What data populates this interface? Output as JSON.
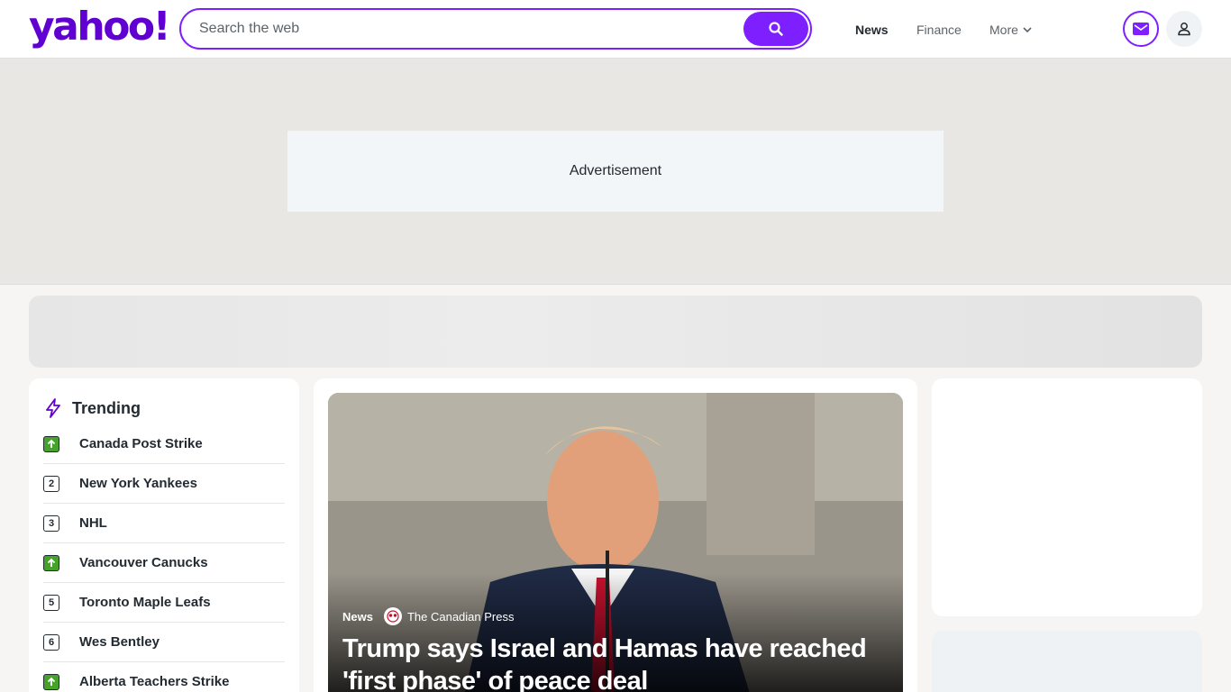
{
  "header": {
    "logo": "yahoo!",
    "search": {
      "placeholder": "Search the web",
      "value": ""
    },
    "nav": {
      "news": "News",
      "finance": "Finance",
      "more": "More"
    }
  },
  "ad": {
    "label": "Advertisement"
  },
  "trending": {
    "title": "Trending",
    "items": [
      {
        "rank": "",
        "label": "Canada Post Strike",
        "trend": "up"
      },
      {
        "rank": "2",
        "label": "New York Yankees",
        "trend": "none"
      },
      {
        "rank": "3",
        "label": "NHL",
        "trend": "none"
      },
      {
        "rank": "",
        "label": "Vancouver Canucks",
        "trend": "up"
      },
      {
        "rank": "5",
        "label": "Toronto Maple Leafs",
        "trend": "none"
      },
      {
        "rank": "6",
        "label": "Wes Bentley",
        "trend": "none"
      },
      {
        "rank": "",
        "label": "Alberta Teachers Strike",
        "trend": "up"
      }
    ]
  },
  "hero": {
    "category": "News",
    "publisher": "The Canadian Press",
    "title": "Trump says Israel and Hamas have reached 'first phase' of peace deal"
  },
  "colors": {
    "brand": "#6001d2",
    "accent": "#7e1fff",
    "trend_up": "#46a32a"
  }
}
